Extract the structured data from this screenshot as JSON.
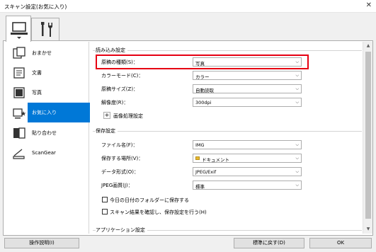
{
  "window": {
    "title": "スキャン設定(お気に入り)",
    "close_glyph": "✕"
  },
  "tabs": [
    {
      "icon": "computer-icon"
    },
    {
      "icon": "tools-icon"
    }
  ],
  "sidebar": {
    "items": [
      {
        "label": "おまかせ",
        "icon": "auto-scan-icon"
      },
      {
        "label": "文書",
        "icon": "document-icon"
      },
      {
        "label": "写真",
        "icon": "photo-icon"
      },
      {
        "label": "お気に入り",
        "icon": "favorites-icon",
        "selected": true
      },
      {
        "label": "貼り合わせ",
        "icon": "stitch-icon"
      },
      {
        "label": "ScanGear",
        "icon": "scangear-icon"
      }
    ]
  },
  "scan_options": {
    "section_title": "読み込み設定",
    "source_type": {
      "label": "原稿の種類(S)：",
      "value": "写真"
    },
    "color_mode": {
      "label": "カラーモード(C)：",
      "value": "カラー"
    },
    "paper_size": {
      "label": "原稿サイズ(Z)：",
      "value": "自動読取"
    },
    "resolution": {
      "label": "解像度(R)：",
      "value": "300dpi"
    },
    "image_processing": {
      "label": "画像処理設定",
      "expand_glyph": "+"
    }
  },
  "save_settings": {
    "section_title": "保存設定",
    "file_name": {
      "label": "ファイル名(F)：",
      "value": "IMG"
    },
    "save_in": {
      "label": "保存する場所(V)：",
      "value": "ドキュメント"
    },
    "data_format": {
      "label": "データ形式(O)：",
      "value": "JPEG/Exif"
    },
    "jpeg_quality": {
      "label": "JPEG画質(J)：",
      "value": "標準"
    },
    "date_folder": {
      "label": "今日の日付のフォルダーに保存する",
      "checked": false
    },
    "check_results": {
      "label": "スキャン結果を確認し、保存設定を行う(H)",
      "checked": false
    }
  },
  "app_settings": {
    "section_title": "アプリケーション設定"
  },
  "footer": {
    "help_label": "操作説明(I)",
    "defaults_label": "標準に戻す(D)",
    "ok_label": "OK"
  },
  "colors": {
    "accent": "#0078d7",
    "highlight": "#e60012"
  }
}
